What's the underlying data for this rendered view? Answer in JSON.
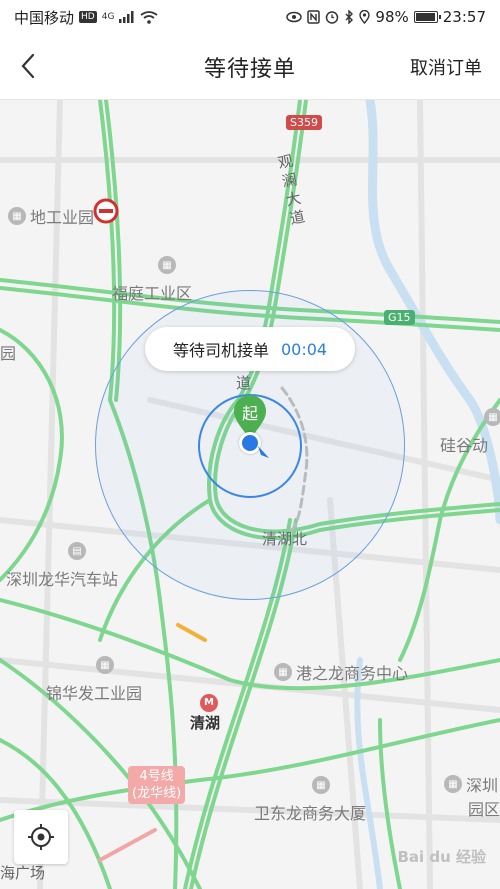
{
  "status_bar": {
    "carrier": "中国移动",
    "network_badge": "HD",
    "network_type": "4G",
    "battery": "98%",
    "battery_level": 0.98,
    "time": "23:57",
    "icons": [
      "eye-icon",
      "nfc-icon",
      "alarm-icon",
      "bluetooth-icon",
      "location-icon"
    ]
  },
  "nav": {
    "title": "等待接单",
    "cancel_label": "取消订单",
    "back_icon": "chevron-left-icon"
  },
  "waiting": {
    "text": "等待司机接单",
    "timer": "00:04"
  },
  "marker": {
    "start_label": "起"
  },
  "map": {
    "pois": [
      {
        "name": "地工业园"
      },
      {
        "name": "福庭工业区"
      },
      {
        "name": "园"
      },
      {
        "name": "深圳龙华汽车站"
      },
      {
        "name": "锦华发工业园"
      },
      {
        "name": "港之龙商务中心"
      },
      {
        "name": "卫东龙商务大厦"
      },
      {
        "name": "硅谷动"
      },
      {
        "name": "深圳"
      },
      {
        "name": "园区"
      }
    ],
    "road_labels": {
      "guanlan": "观澜大道",
      "dao": "道",
      "qinghu_north": "清湖北",
      "qinghu": "清湖",
      "square": "海广场"
    },
    "badges": {
      "s359": "S359",
      "g15": "G15",
      "metro_line": "4号线",
      "metro_line_name": "(龙华线)"
    }
  },
  "watermark": "Bai du 经验",
  "colors": {
    "road_green": "#7fd68f",
    "accent_blue": "#2a7ee6",
    "marker_green": "#4caf50"
  }
}
